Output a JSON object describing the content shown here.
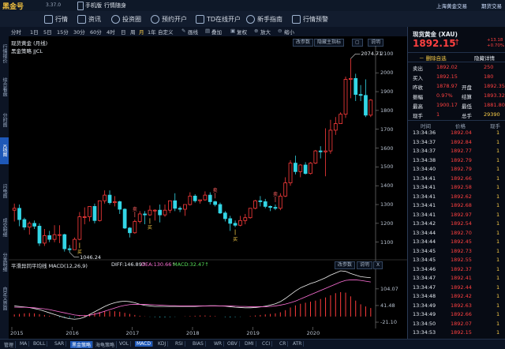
{
  "app": {
    "logo": "黑金号",
    "version": "3.37.0",
    "phone_label": "手机版",
    "follow_label": "行情随身",
    "top_right_link": "上海黄金交易",
    "top_right_link2": "期货交易"
  },
  "nav": [
    {
      "label": "行情",
      "icon": "chart-icon"
    },
    {
      "label": "资讯",
      "icon": "news-icon"
    },
    {
      "label": "投资圈",
      "icon": "globe-icon"
    },
    {
      "label": "预约开户",
      "icon": "clock-icon"
    },
    {
      "label": "TD在线开户",
      "icon": "td-icon"
    },
    {
      "label": "新手指南",
      "icon": "gear-icon"
    },
    {
      "label": "行情预警",
      "icon": "bell-icon"
    }
  ],
  "timeframes": [
    "分时",
    "1日",
    "5日",
    "15分",
    "30分",
    "60分",
    "4时",
    "日",
    "周",
    "月线",
    "1年",
    "自定义"
  ],
  "timeframe_active": "月",
  "tools": [
    "画线",
    "叠加",
    "复权",
    "放大",
    "缩小"
  ],
  "left_tabs": [
    {
      "label": "行情报价"
    },
    {
      "label": "综合看盘"
    },
    {
      "label": "分时图"
    },
    {
      "label": "K线图",
      "active": true
    },
    {
      "label": "闪电图"
    },
    {
      "label": "成交明细"
    },
    {
      "label": "分类明细"
    },
    {
      "label": "自定义界面"
    }
  ],
  "chart_header": {
    "title": "现货黄金 (月线)",
    "indicator": "黑金策略 JJCL",
    "buttons": [
      "改参数",
      "隐藏主指标",
      "▢",
      "说明"
    ]
  },
  "macd_header": {
    "label": "平滑异同平均线 MACD(12,26,9)",
    "diff": "DIFF:146.89↑",
    "dea": "DEA:130.66↑",
    "macd": "MACD:32.47↑",
    "buttons": [
      "改参数",
      "说明",
      "X"
    ]
  },
  "chart_data": {
    "type": "candlestick",
    "y_ticks": [
      2100,
      2000,
      1900,
      1800,
      1700,
      1600,
      1500,
      1400,
      1300,
      1200,
      1100
    ],
    "ylim": [
      1040,
      2110
    ],
    "x_ticks": [
      "2015",
      "2016",
      "2017",
      "2018",
      "2019",
      "2020"
    ],
    "annotations": [
      {
        "label": "2074.71"
      },
      {
        "label": "1046.24"
      }
    ],
    "macd_ticks": [
      "104.07",
      "41.48",
      "-21.10"
    ],
    "macd_ylim": [
      -30,
      175
    ],
    "buy_markers": [
      {
        "label": "买"
      },
      {
        "label": "买"
      },
      {
        "label": "买"
      }
    ],
    "sell_markers": [
      {
        "label": "卖"
      },
      {
        "label": "卖"
      },
      {
        "label": "卖"
      }
    ],
    "ohlc": [
      [
        1270,
        1305,
        1210,
        1280
      ],
      [
        1280,
        1300,
        1185,
        1220
      ],
      [
        1220,
        1230,
        1165,
        1180
      ],
      [
        1180,
        1210,
        1140,
        1200
      ],
      [
        1200,
        1215,
        1170,
        1185
      ],
      [
        1185,
        1200,
        1080,
        1095
      ],
      [
        1095,
        1170,
        1080,
        1135
      ],
      [
        1135,
        1160,
        1100,
        1115
      ],
      [
        1115,
        1190,
        1100,
        1140
      ],
      [
        1140,
        1190,
        1095,
        1140
      ],
      [
        1140,
        1145,
        1050,
        1065
      ],
      [
        1065,
        1085,
        1046,
        1060
      ],
      [
        1060,
        1125,
        1060,
        1115
      ],
      [
        1115,
        1260,
        1110,
        1235
      ],
      [
        1235,
        1285,
        1195,
        1235
      ],
      [
        1235,
        1265,
        1210,
        1290
      ],
      [
        1290,
        1305,
        1200,
        1215
      ],
      [
        1215,
        1295,
        1210,
        1320
      ],
      [
        1320,
        1375,
        1305,
        1350
      ],
      [
        1350,
        1375,
        1300,
        1310
      ],
      [
        1310,
        1345,
        1290,
        1315
      ],
      [
        1315,
        1320,
        1250,
        1275
      ],
      [
        1275,
        1280,
        1170,
        1175
      ],
      [
        1175,
        1180,
        1125,
        1150
      ],
      [
        1150,
        1220,
        1145,
        1210
      ],
      [
        1210,
        1265,
        1200,
        1250
      ],
      [
        1250,
        1265,
        1195,
        1245
      ],
      [
        1245,
        1295,
        1240,
        1270
      ],
      [
        1270,
        1275,
        1215,
        1270
      ],
      [
        1270,
        1300,
        1205,
        1245
      ],
      [
        1245,
        1300,
        1235,
        1270
      ],
      [
        1270,
        1310,
        1255,
        1320
      ],
      [
        1320,
        1360,
        1265,
        1280
      ],
      [
        1280,
        1290,
        1260,
        1275
      ],
      [
        1275,
        1300,
        1240,
        1300
      ],
      [
        1300,
        1365,
        1295,
        1345
      ],
      [
        1345,
        1355,
        1310,
        1320
      ],
      [
        1320,
        1325,
        1305,
        1325
      ],
      [
        1325,
        1370,
        1320,
        1350
      ],
      [
        1350,
        1365,
        1300,
        1315
      ],
      [
        1315,
        1320,
        1290,
        1300
      ],
      [
        1300,
        1310,
        1250,
        1255
      ],
      [
        1255,
        1265,
        1210,
        1225
      ],
      [
        1225,
        1240,
        1160,
        1200
      ],
      [
        1200,
        1215,
        1180,
        1190
      ],
      [
        1190,
        1240,
        1185,
        1215
      ],
      [
        1215,
        1250,
        1195,
        1230
      ],
      [
        1230,
        1280,
        1225,
        1280
      ],
      [
        1280,
        1325,
        1275,
        1320
      ],
      [
        1320,
        1345,
        1290,
        1315
      ],
      [
        1315,
        1330,
        1280,
        1290
      ],
      [
        1290,
        1295,
        1265,
        1285
      ],
      [
        1285,
        1300,
        1270,
        1280
      ],
      [
        1280,
        1360,
        1270,
        1345
      ],
      [
        1345,
        1445,
        1340,
        1415
      ],
      [
        1415,
        1535,
        1400,
        1520
      ],
      [
        1520,
        1560,
        1460,
        1475
      ],
      [
        1475,
        1515,
        1445,
        1510
      ],
      [
        1510,
        1525,
        1460,
        1465
      ],
      [
        1465,
        1525,
        1460,
        1520
      ],
      [
        1520,
        1590,
        1515,
        1585
      ],
      [
        1585,
        1610,
        1545,
        1580
      ],
      [
        1580,
        1705,
        1450,
        1585
      ],
      [
        1585,
        1750,
        1570,
        1695
      ],
      [
        1695,
        1765,
        1670,
        1730
      ],
      [
        1730,
        1790,
        1735,
        1780
      ],
      [
        1780,
        1980,
        1760,
        1965
      ],
      [
        1965,
        2075,
        1865,
        1970
      ],
      [
        1970,
        1995,
        1850,
        1885
      ],
      [
        1885,
        1935,
        1850,
        1880
      ],
      [
        1880,
        1965,
        1765,
        1775
      ],
      [
        1775,
        1860,
        1765,
        1855
      ]
    ],
    "macd_bars": [
      8,
      10,
      12,
      13,
      12,
      9,
      6,
      3,
      1,
      -2,
      -3,
      -4,
      -2,
      2,
      6,
      10,
      14,
      17,
      19,
      21,
      20,
      18,
      14,
      10,
      6,
      3,
      1,
      -1,
      -2,
      -3,
      -3,
      -2,
      -1,
      0,
      1,
      2,
      3,
      4,
      4,
      3,
      2,
      0,
      -2,
      -3,
      -2,
      -1,
      0,
      2,
      4,
      6,
      8,
      10,
      12,
      16,
      24,
      34,
      42,
      48,
      52,
      56,
      60,
      66,
      72,
      80,
      88,
      92,
      90,
      76,
      60,
      46,
      38,
      32
    ],
    "diff_line": [
      40,
      38,
      36,
      34,
      30,
      26,
      20,
      14,
      8,
      2,
      -4,
      -8,
      -10,
      -8,
      -2,
      8,
      18,
      28,
      38,
      46,
      52,
      56,
      58,
      56,
      52,
      46,
      42,
      40,
      38,
      38,
      38,
      38,
      38,
      38,
      38,
      38,
      38,
      39,
      40,
      41,
      41,
      40,
      39,
      37,
      35,
      34,
      33,
      33,
      34,
      36,
      39,
      43,
      48,
      56,
      68,
      82,
      96,
      108,
      116,
      124,
      130,
      138,
      146,
      156,
      164,
      172,
      170,
      162,
      156,
      150,
      148,
      146
    ],
    "dea_line": [
      35,
      35,
      35,
      34,
      33,
      31,
      29,
      26,
      22,
      18,
      14,
      10,
      6,
      4,
      3,
      5,
      9,
      14,
      20,
      26,
      32,
      38,
      42,
      45,
      46,
      46,
      46,
      45,
      44,
      43,
      42,
      41,
      41,
      40,
      40,
      40,
      40,
      40,
      40,
      40,
      40,
      40,
      40,
      40,
      39,
      38,
      38,
      37,
      37,
      37,
      37,
      38,
      40,
      43,
      47,
      52,
      58,
      66,
      74,
      82,
      90,
      98,
      106,
      114,
      122,
      130,
      136,
      138,
      138,
      136,
      133,
      130
    ]
  },
  "right_panel": {
    "title": "现货黄金 (XAU)",
    "price": "1892.15",
    "arrow": "↑",
    "change": "+13.18",
    "change_pct": "+0.70%",
    "remove_watch": "删除自选",
    "hide_trades": "隐藏详情",
    "quote_rows": [
      {
        "l1": "卖出",
        "v1": "1892.02",
        "l2": "",
        "v2": "250"
      },
      {
        "l1": "买入",
        "v1": "1892.15",
        "l2": "",
        "v2": "180"
      },
      {
        "l1": "昨收",
        "v1": "1878.97",
        "l2": "开盘",
        "v2": "1892.35"
      },
      {
        "l1": "振幅",
        "v1": "0.97%",
        "l2": "结算",
        "v2": "1893.32"
      },
      {
        "l1": "最高",
        "v1": "1900.17",
        "l2": "最低",
        "v2": "1881.80"
      },
      {
        "l1": "现手",
        "v1": "1",
        "l2": "总手",
        "v2": "29390"
      }
    ],
    "tick_header": [
      "时间",
      "价格",
      "现手"
    ],
    "ticks": [
      [
        "13:34:36",
        "1892.04",
        "1"
      ],
      [
        "13:34:37",
        "1892.84",
        "1"
      ],
      [
        "13:34:37",
        "1892.77",
        "1"
      ],
      [
        "13:34:38",
        "1892.79",
        "1"
      ],
      [
        "13:34:40",
        "1892.79",
        "1"
      ],
      [
        "13:34:41",
        "1892.66",
        "1"
      ],
      [
        "13:34:41",
        "1892.58",
        "1"
      ],
      [
        "13:34:41",
        "1892.62",
        "1"
      ],
      [
        "13:34:41",
        "1892.68",
        "1"
      ],
      [
        "13:34:41",
        "1892.97",
        "1"
      ],
      [
        "13:34:42",
        "1892.54",
        "1"
      ],
      [
        "13:34:44",
        "1892.70",
        "1"
      ],
      [
        "13:34:44",
        "1892.45",
        "1"
      ],
      [
        "13:34:45",
        "1892.73",
        "1"
      ],
      [
        "13:34:45",
        "1892.55",
        "1"
      ],
      [
        "13:34:46",
        "1892.37",
        "1"
      ],
      [
        "13:34:47",
        "1892.41",
        "1"
      ],
      [
        "13:34:47",
        "1892.44",
        "1"
      ],
      [
        "13:34:48",
        "1892.42",
        "1"
      ],
      [
        "13:34:49",
        "1892.63",
        "1"
      ],
      [
        "13:34:49",
        "1892.66",
        "1"
      ],
      [
        "13:34:50",
        "1892.07",
        "1"
      ],
      [
        "13:34:53",
        "1892.15",
        "1"
      ]
    ]
  },
  "bottom_tabs": [
    "管理",
    "MA",
    "BOLL",
    "SAR",
    "黑金策略",
    "海龟策略",
    "VOL",
    "MACD",
    "KDJ",
    "RSI",
    "BIAS",
    "WR",
    "OBV",
    "DMI",
    "CCI",
    "CR",
    "ATR"
  ],
  "bottom_active": [
    "黑金策略",
    "MACD"
  ]
}
